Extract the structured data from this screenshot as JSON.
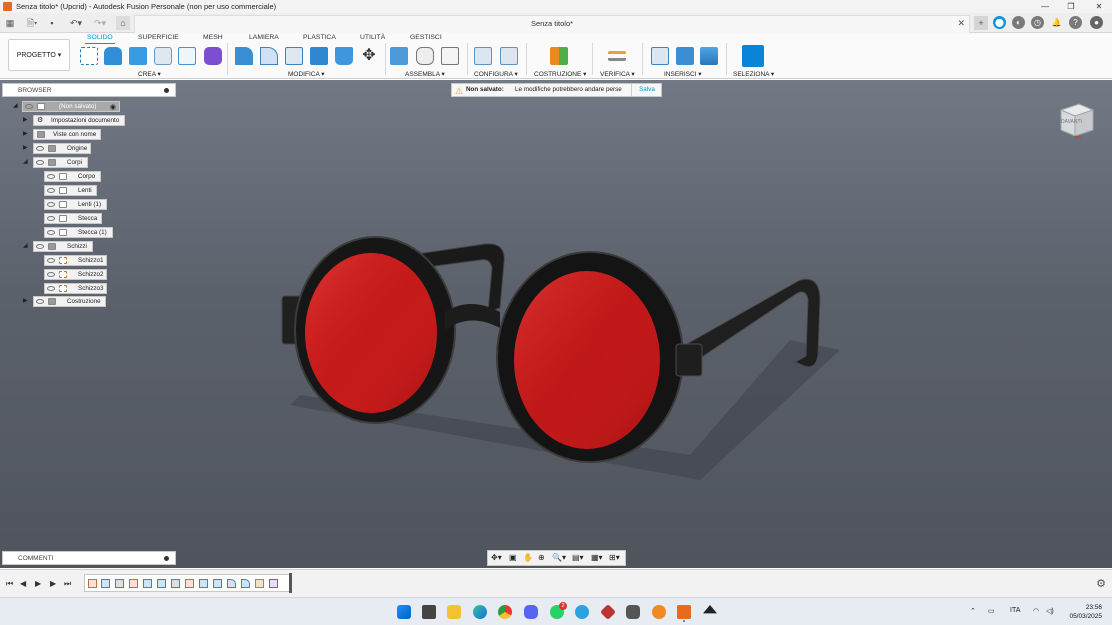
{
  "window": {
    "title": "Senza titolo* (Upcrid) - Autodesk Fusion Personale (non per uso commerciale)",
    "document_tab": "Senza titolo*",
    "minimize": "—",
    "maximize": "❐",
    "close": "✕"
  },
  "ribbon": {
    "project_button": "PROGETTO ▾",
    "tabs": [
      "SOLIDO",
      "SUPERFICIE",
      "MESH",
      "LAMIERA",
      "PLASTICA",
      "UTILITÀ",
      "GESTISCI"
    ],
    "active_tab": "SOLIDO",
    "groups": [
      "CREA ▾",
      "MODIFICA ▾",
      "ASSEMBLA ▾",
      "CONFIGURA ▾",
      "COSTRUZIONE ▾",
      "VERIFICA ▾",
      "INSERISCI ▾",
      "SELEZIONA ▾"
    ]
  },
  "browser": {
    "title": "BROWSER",
    "root": "(Non salvato)",
    "items": [
      {
        "label": "Impostazioni documento"
      },
      {
        "label": "Viste con nome"
      },
      {
        "label": "Origine"
      },
      {
        "label": "Corpi"
      },
      {
        "label": "Corpo"
      },
      {
        "label": "Lenti"
      },
      {
        "label": "Lenti (1)"
      },
      {
        "label": "Stecca"
      },
      {
        "label": "Stecca (1)"
      },
      {
        "label": "Schizzi"
      },
      {
        "label": "Schizzo1"
      },
      {
        "label": "Schizzo2"
      },
      {
        "label": "Schizzo3"
      },
      {
        "label": "Costruzione"
      }
    ]
  },
  "warning": {
    "bold": "Non salvato:",
    "message": "Le modifiche potrebbero andare perse",
    "action": "Salva"
  },
  "viewcube": {
    "face": "DAVANTI"
  },
  "comments": {
    "title": "COMMENTI"
  },
  "taskbar": {
    "language": "ITA",
    "time": "23:56",
    "date": "05/03/2025",
    "telegram_badge": "2"
  },
  "colors": {
    "accent": "#0696d7",
    "lens": "#c41a1a",
    "frame": "#1c1c1c"
  }
}
